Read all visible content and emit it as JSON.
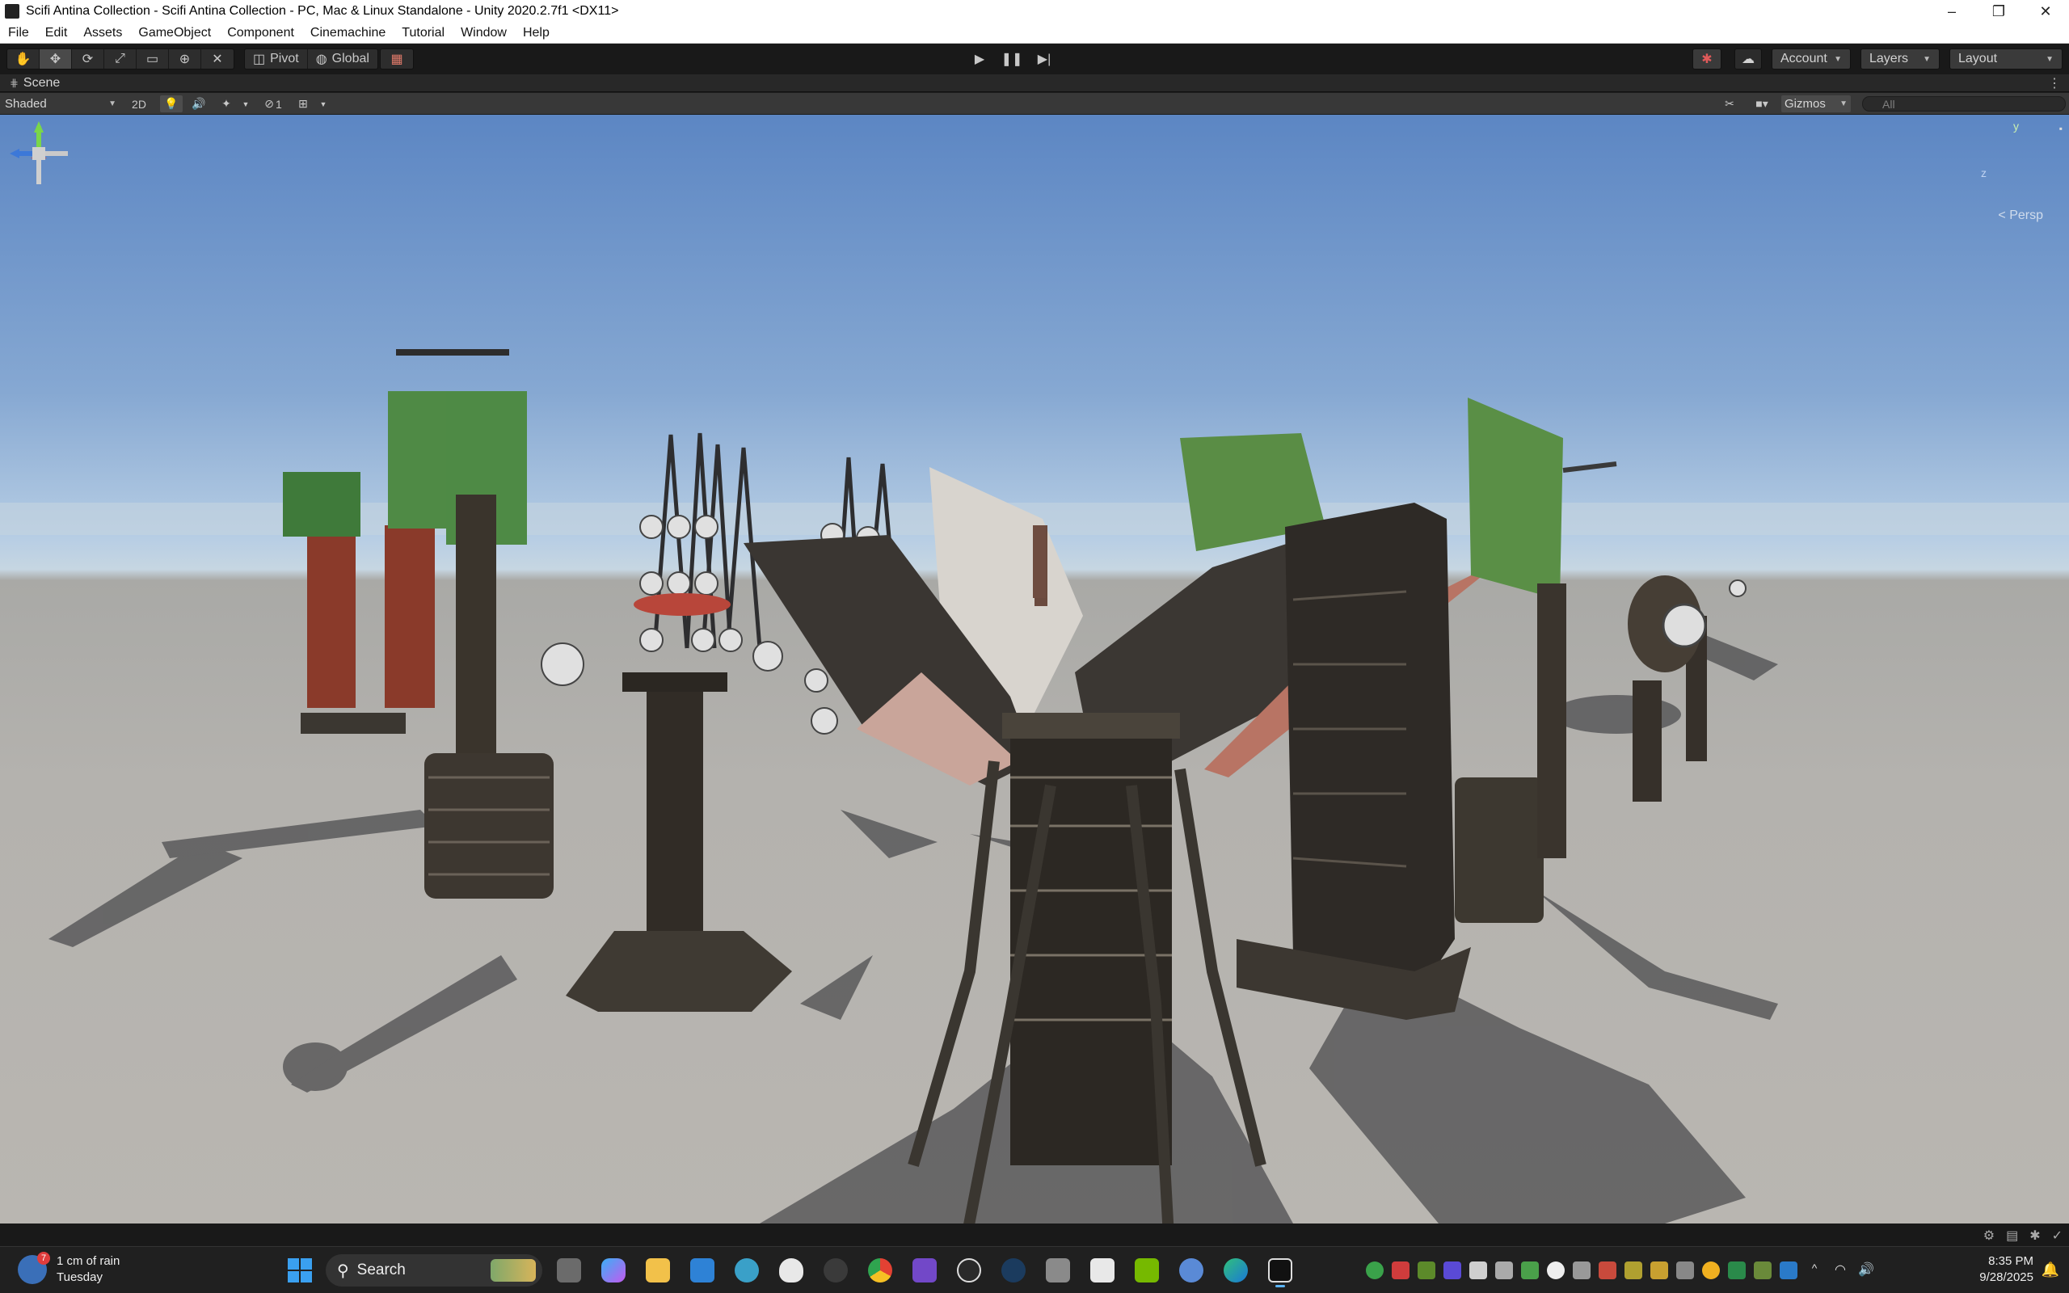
{
  "window": {
    "title": "Scifi Antina Collection - Scifi Antina Collection - PC, Mac & Linux Standalone - Unity 2020.2.7f1 <DX11>",
    "controls": [
      "–",
      "❐",
      "✕"
    ]
  },
  "menu": [
    "File",
    "Edit",
    "Assets",
    "GameObject",
    "Component",
    "Cinemachine",
    "Tutorial",
    "Window",
    "Help"
  ],
  "toolbar": {
    "pivot_label": "Pivot",
    "global_label": "Global",
    "account_label": "Account",
    "layers_label": "Layers",
    "layout_label": "Layout"
  },
  "scene_tab": {
    "label": "Scene"
  },
  "scene_bar": {
    "shading_mode": "Shaded",
    "toggle_2d": "2D",
    "hidden_count": "1",
    "gizmos_label": "Gizmos",
    "search_placeholder": "All"
  },
  "gizmo": {
    "projection_label": "< Persp",
    "axis_y": "y",
    "axis_z": "z"
  },
  "taskbar": {
    "weather_line1": "1 cm of rain",
    "weather_line2": "Tuesday",
    "weather_badge": "7",
    "search_label": "Search",
    "time": "8:35 PM",
    "date": "9/28/2025"
  },
  "colors": {
    "accent": "#5bb4f5",
    "toolbar_bg": "#191919",
    "scene_bar_bg": "#383838"
  }
}
